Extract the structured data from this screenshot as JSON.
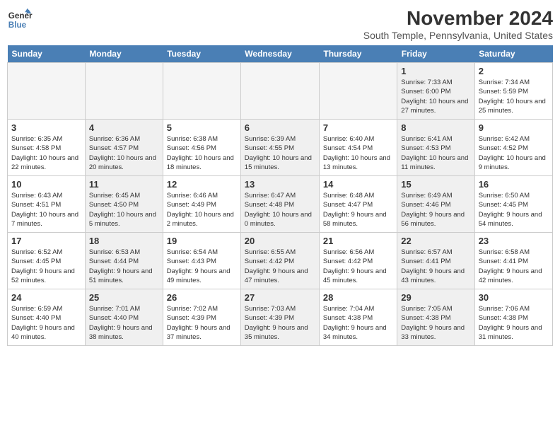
{
  "logo": {
    "line1": "General",
    "line2": "Blue"
  },
  "title": "November 2024",
  "location": "South Temple, Pennsylvania, United States",
  "headers": [
    "Sunday",
    "Monday",
    "Tuesday",
    "Wednesday",
    "Thursday",
    "Friday",
    "Saturday"
  ],
  "weeks": [
    [
      {
        "day": "",
        "info": "",
        "empty": true
      },
      {
        "day": "",
        "info": "",
        "empty": true
      },
      {
        "day": "",
        "info": "",
        "empty": true
      },
      {
        "day": "",
        "info": "",
        "empty": true
      },
      {
        "day": "",
        "info": "",
        "empty": true
      },
      {
        "day": "1",
        "info": "Sunrise: 7:33 AM\nSunset: 6:00 PM\nDaylight: 10 hours and 27 minutes.",
        "shaded": true
      },
      {
        "day": "2",
        "info": "Sunrise: 7:34 AM\nSunset: 5:59 PM\nDaylight: 10 hours and 25 minutes.",
        "shaded": false
      }
    ],
    [
      {
        "day": "3",
        "info": "Sunrise: 6:35 AM\nSunset: 4:58 PM\nDaylight: 10 hours and 22 minutes.",
        "shaded": false
      },
      {
        "day": "4",
        "info": "Sunrise: 6:36 AM\nSunset: 4:57 PM\nDaylight: 10 hours and 20 minutes.",
        "shaded": true
      },
      {
        "day": "5",
        "info": "Sunrise: 6:38 AM\nSunset: 4:56 PM\nDaylight: 10 hours and 18 minutes.",
        "shaded": false
      },
      {
        "day": "6",
        "info": "Sunrise: 6:39 AM\nSunset: 4:55 PM\nDaylight: 10 hours and 15 minutes.",
        "shaded": true
      },
      {
        "day": "7",
        "info": "Sunrise: 6:40 AM\nSunset: 4:54 PM\nDaylight: 10 hours and 13 minutes.",
        "shaded": false
      },
      {
        "day": "8",
        "info": "Sunrise: 6:41 AM\nSunset: 4:53 PM\nDaylight: 10 hours and 11 minutes.",
        "shaded": true
      },
      {
        "day": "9",
        "info": "Sunrise: 6:42 AM\nSunset: 4:52 PM\nDaylight: 10 hours and 9 minutes.",
        "shaded": false
      }
    ],
    [
      {
        "day": "10",
        "info": "Sunrise: 6:43 AM\nSunset: 4:51 PM\nDaylight: 10 hours and 7 minutes.",
        "shaded": false
      },
      {
        "day": "11",
        "info": "Sunrise: 6:45 AM\nSunset: 4:50 PM\nDaylight: 10 hours and 5 minutes.",
        "shaded": true
      },
      {
        "day": "12",
        "info": "Sunrise: 6:46 AM\nSunset: 4:49 PM\nDaylight: 10 hours and 2 minutes.",
        "shaded": false
      },
      {
        "day": "13",
        "info": "Sunrise: 6:47 AM\nSunset: 4:48 PM\nDaylight: 10 hours and 0 minutes.",
        "shaded": true
      },
      {
        "day": "14",
        "info": "Sunrise: 6:48 AM\nSunset: 4:47 PM\nDaylight: 9 hours and 58 minutes.",
        "shaded": false
      },
      {
        "day": "15",
        "info": "Sunrise: 6:49 AM\nSunset: 4:46 PM\nDaylight: 9 hours and 56 minutes.",
        "shaded": true
      },
      {
        "day": "16",
        "info": "Sunrise: 6:50 AM\nSunset: 4:45 PM\nDaylight: 9 hours and 54 minutes.",
        "shaded": false
      }
    ],
    [
      {
        "day": "17",
        "info": "Sunrise: 6:52 AM\nSunset: 4:45 PM\nDaylight: 9 hours and 52 minutes.",
        "shaded": false
      },
      {
        "day": "18",
        "info": "Sunrise: 6:53 AM\nSunset: 4:44 PM\nDaylight: 9 hours and 51 minutes.",
        "shaded": true
      },
      {
        "day": "19",
        "info": "Sunrise: 6:54 AM\nSunset: 4:43 PM\nDaylight: 9 hours and 49 minutes.",
        "shaded": false
      },
      {
        "day": "20",
        "info": "Sunrise: 6:55 AM\nSunset: 4:42 PM\nDaylight: 9 hours and 47 minutes.",
        "shaded": true
      },
      {
        "day": "21",
        "info": "Sunrise: 6:56 AM\nSunset: 4:42 PM\nDaylight: 9 hours and 45 minutes.",
        "shaded": false
      },
      {
        "day": "22",
        "info": "Sunrise: 6:57 AM\nSunset: 4:41 PM\nDaylight: 9 hours and 43 minutes.",
        "shaded": true
      },
      {
        "day": "23",
        "info": "Sunrise: 6:58 AM\nSunset: 4:41 PM\nDaylight: 9 hours and 42 minutes.",
        "shaded": false
      }
    ],
    [
      {
        "day": "24",
        "info": "Sunrise: 6:59 AM\nSunset: 4:40 PM\nDaylight: 9 hours and 40 minutes.",
        "shaded": false
      },
      {
        "day": "25",
        "info": "Sunrise: 7:01 AM\nSunset: 4:40 PM\nDaylight: 9 hours and 38 minutes.",
        "shaded": true
      },
      {
        "day": "26",
        "info": "Sunrise: 7:02 AM\nSunset: 4:39 PM\nDaylight: 9 hours and 37 minutes.",
        "shaded": false
      },
      {
        "day": "27",
        "info": "Sunrise: 7:03 AM\nSunset: 4:39 PM\nDaylight: 9 hours and 35 minutes.",
        "shaded": true
      },
      {
        "day": "28",
        "info": "Sunrise: 7:04 AM\nSunset: 4:38 PM\nDaylight: 9 hours and 34 minutes.",
        "shaded": false
      },
      {
        "day": "29",
        "info": "Sunrise: 7:05 AM\nSunset: 4:38 PM\nDaylight: 9 hours and 33 minutes.",
        "shaded": true
      },
      {
        "day": "30",
        "info": "Sunrise: 7:06 AM\nSunset: 4:38 PM\nDaylight: 9 hours and 31 minutes.",
        "shaded": false
      }
    ]
  ]
}
